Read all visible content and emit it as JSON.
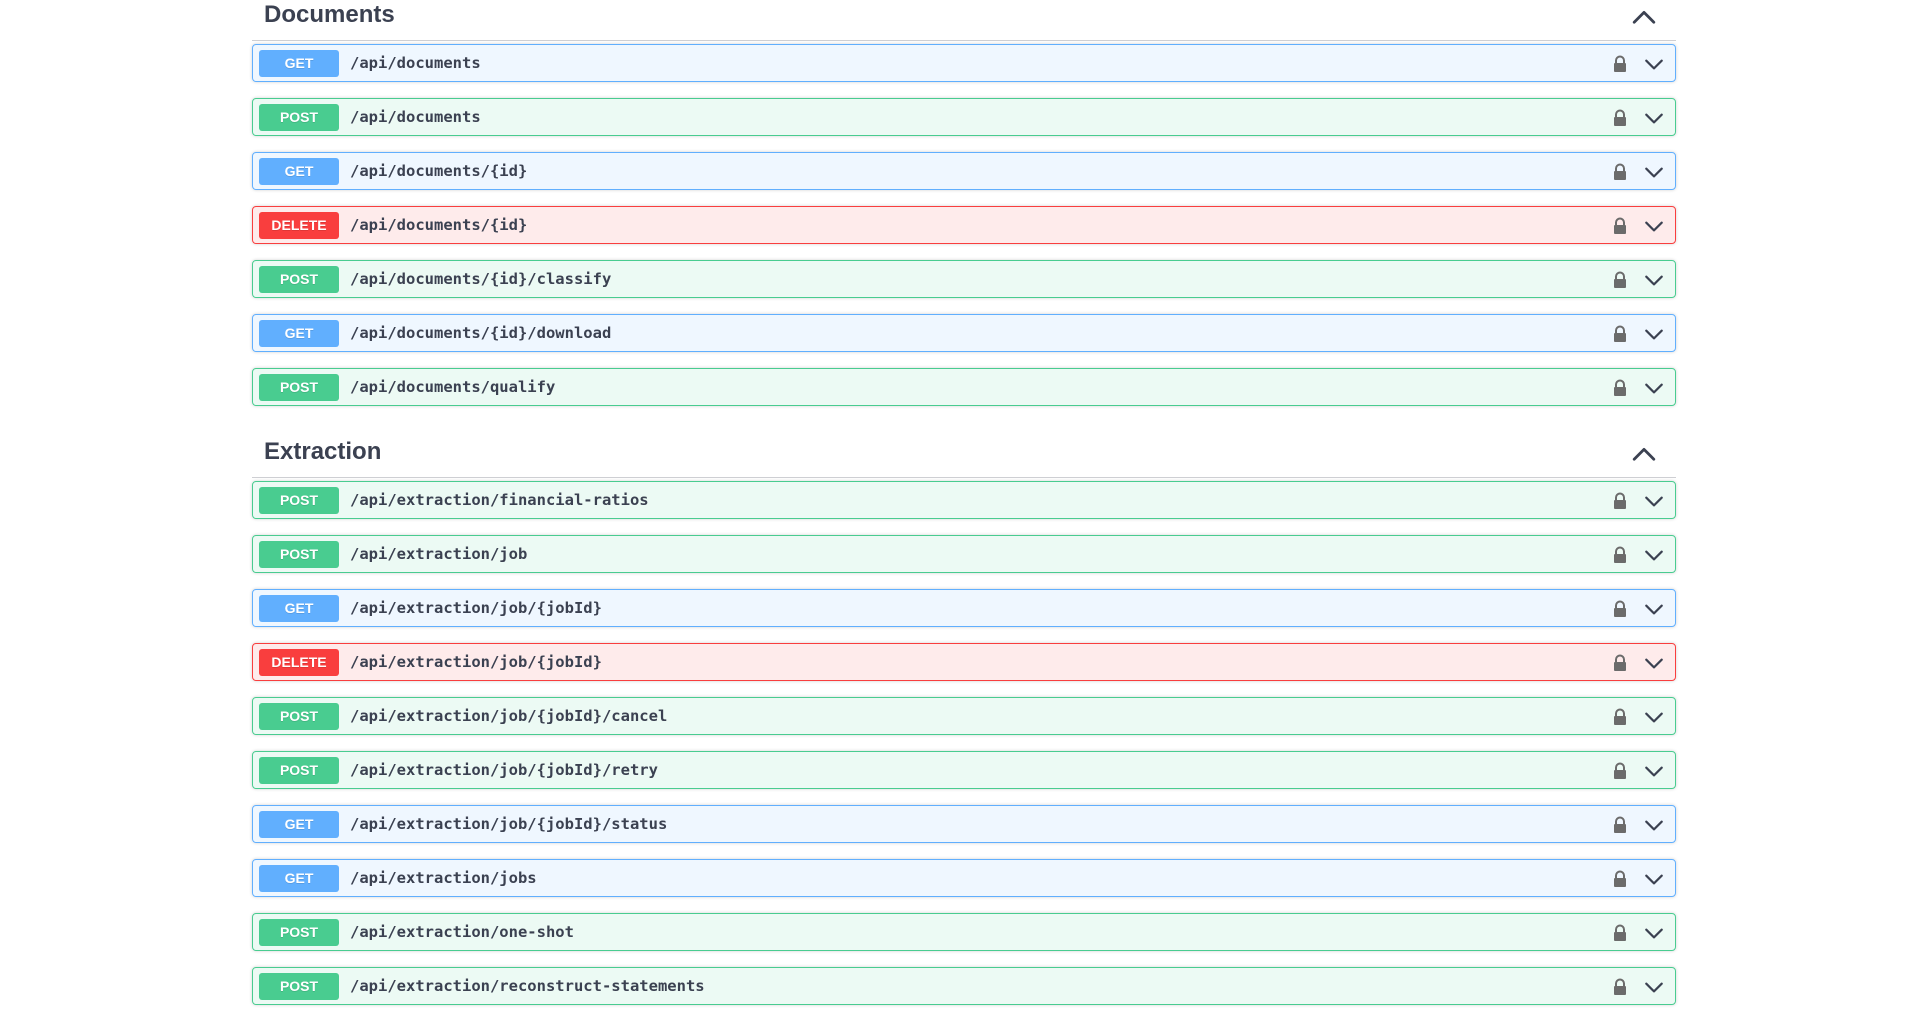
{
  "colors": {
    "get": "#61affe",
    "post": "#49cc90",
    "delete": "#f93e3e",
    "text": "#3b4151"
  },
  "sections": [
    {
      "title": "Documents",
      "operations": [
        {
          "method": "GET",
          "path": "/api/documents"
        },
        {
          "method": "POST",
          "path": "/api/documents"
        },
        {
          "method": "GET",
          "path": "/api/documents/{id}"
        },
        {
          "method": "DELETE",
          "path": "/api/documents/{id}"
        },
        {
          "method": "POST",
          "path": "/api/documents/{id}/classify"
        },
        {
          "method": "GET",
          "path": "/api/documents/{id}/download"
        },
        {
          "method": "POST",
          "path": "/api/documents/qualify"
        }
      ]
    },
    {
      "title": "Extraction",
      "operations": [
        {
          "method": "POST",
          "path": "/api/extraction/financial-ratios"
        },
        {
          "method": "POST",
          "path": "/api/extraction/job"
        },
        {
          "method": "GET",
          "path": "/api/extraction/job/{jobId}"
        },
        {
          "method": "DELETE",
          "path": "/api/extraction/job/{jobId}"
        },
        {
          "method": "POST",
          "path": "/api/extraction/job/{jobId}/cancel"
        },
        {
          "method": "POST",
          "path": "/api/extraction/job/{jobId}/retry"
        },
        {
          "method": "GET",
          "path": "/api/extraction/job/{jobId}/status"
        },
        {
          "method": "GET",
          "path": "/api/extraction/jobs"
        },
        {
          "method": "POST",
          "path": "/api/extraction/one-shot"
        },
        {
          "method": "POST",
          "path": "/api/extraction/reconstruct-statements"
        }
      ]
    }
  ],
  "icons": {
    "section_toggle": "chevron-up-icon",
    "lock": "lock-icon",
    "expand": "chevron-down-icon"
  }
}
